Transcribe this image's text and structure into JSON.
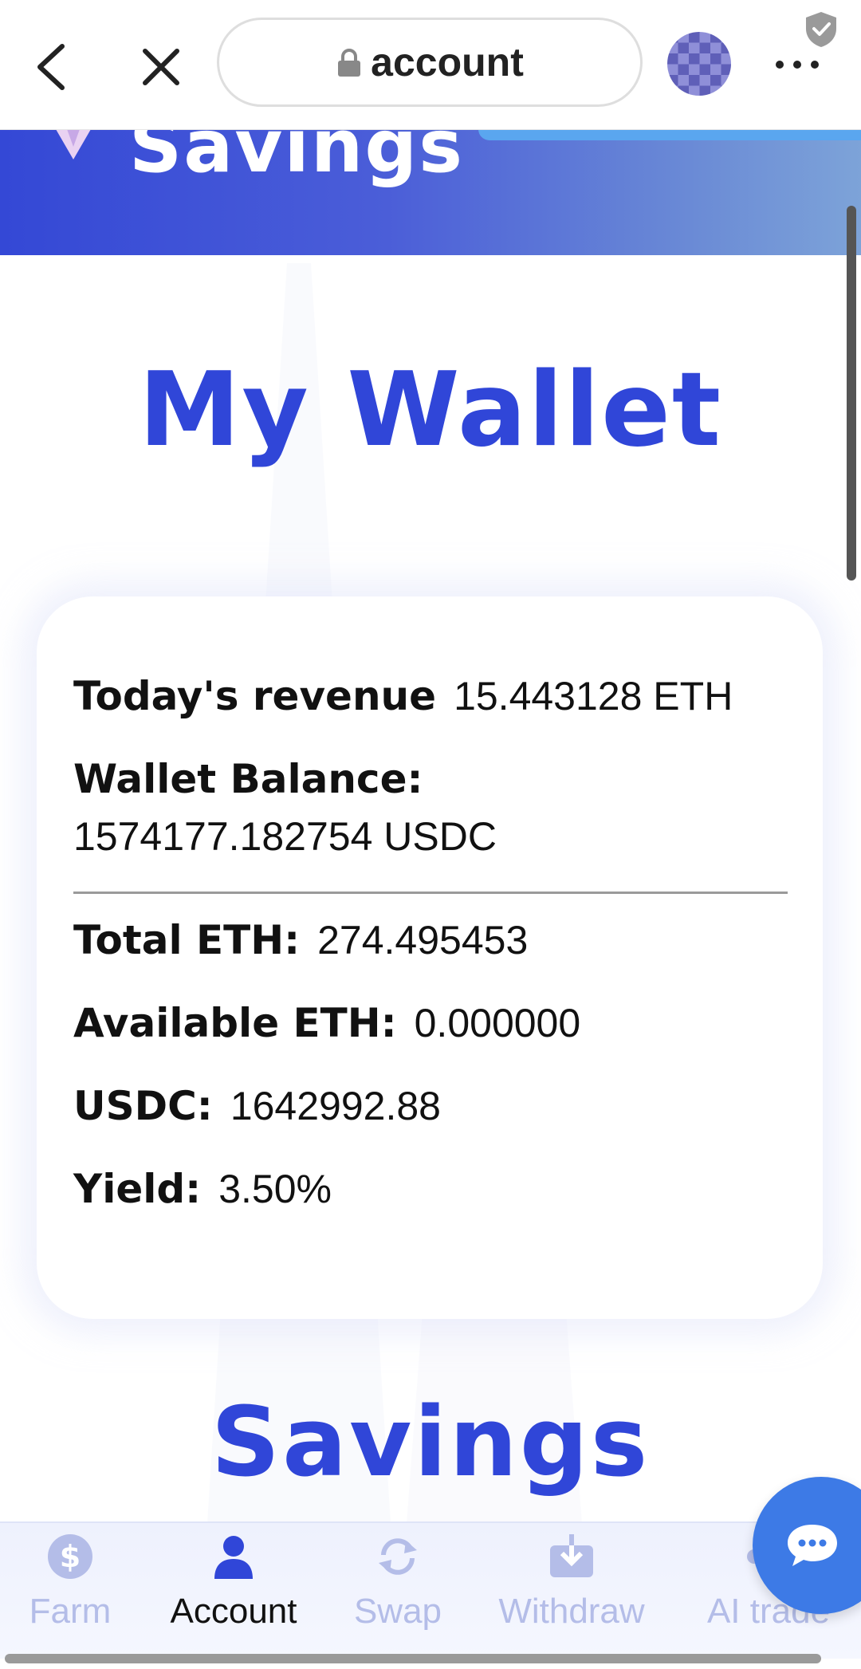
{
  "browser": {
    "url_text": "account"
  },
  "banner": {
    "title": "Savings"
  },
  "page": {
    "title": "My Wallet",
    "section_title": "Savings"
  },
  "wallet": {
    "todays_revenue_label": "Today's revenue",
    "todays_revenue_value": "15.443128 ETH",
    "wallet_balance_label": "Wallet Balance:",
    "wallet_balance_value": "1574177.182754 USDC",
    "total_eth_label": "Total ETH:",
    "total_eth_value": "274.495453",
    "available_eth_label": "Available ETH:",
    "available_eth_value": "0.000000",
    "usdc_label": "USDC:",
    "usdc_value": "1642992.88",
    "yield_label": "Yield:",
    "yield_value": "3.50%"
  },
  "tabs": [
    {
      "label": "Farm",
      "icon": "dollar-icon",
      "active": false
    },
    {
      "label": "Account",
      "icon": "user-icon",
      "active": true
    },
    {
      "label": "Swap",
      "icon": "swap-icon",
      "active": false
    },
    {
      "label": "Withdraw",
      "icon": "download-icon",
      "active": false
    },
    {
      "label": "AI trade",
      "icon": "share-icon",
      "active": false
    }
  ],
  "colors": {
    "accent": "#3046d8",
    "tab_inactive": "#b4bde8",
    "chat_button": "#3d7ae6"
  }
}
